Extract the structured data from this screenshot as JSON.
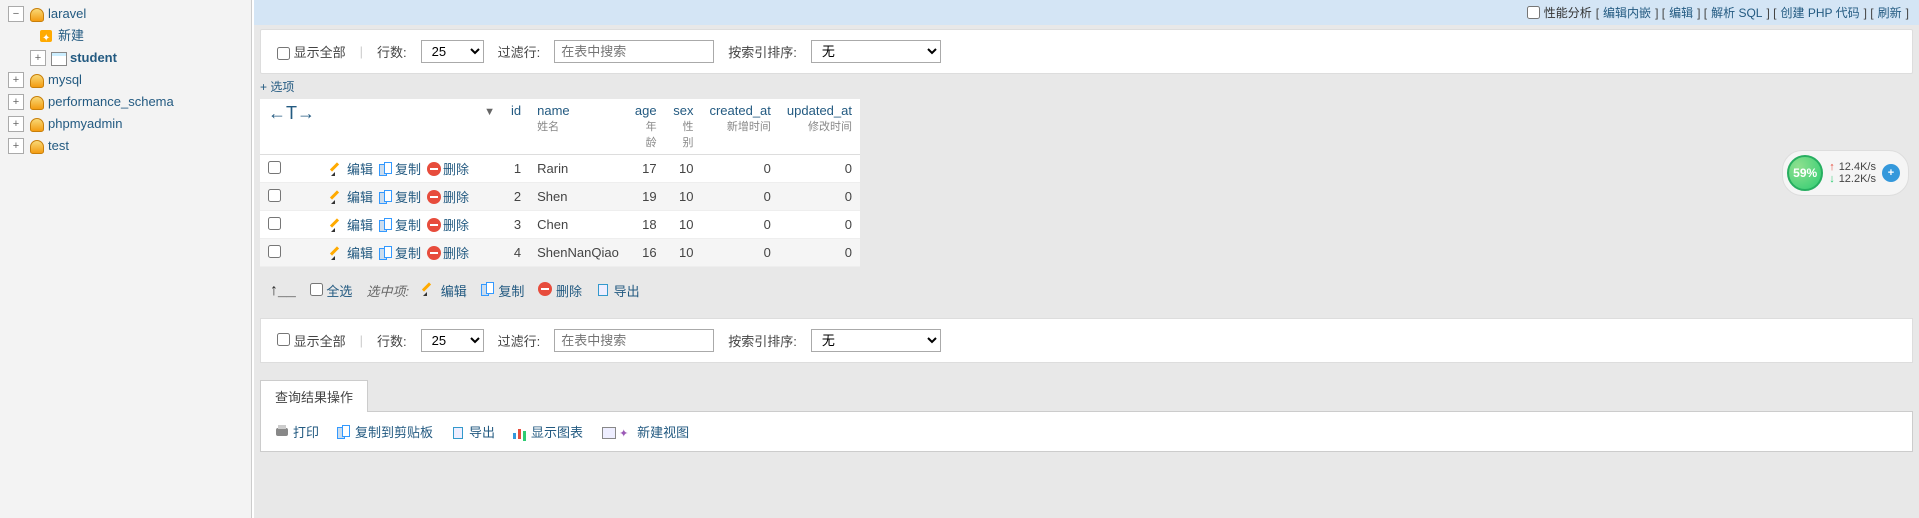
{
  "sidebar": {
    "items": [
      {
        "label": "laravel",
        "open": true,
        "icon": "db",
        "children": [
          {
            "label": "新建",
            "icon": "new"
          },
          {
            "label": "student",
            "icon": "table",
            "selected": true
          }
        ]
      },
      {
        "label": "mysql",
        "open": false,
        "icon": "db"
      },
      {
        "label": "performance_schema",
        "open": false,
        "icon": "db"
      },
      {
        "label": "phpmyadmin",
        "open": false,
        "icon": "db"
      },
      {
        "label": "test",
        "open": false,
        "icon": "db"
      }
    ]
  },
  "topbar": {
    "perf_label": "性能分析",
    "links": [
      "编辑内嵌",
      "编辑",
      "解析 SQL",
      "创建 PHP 代码",
      "刷新"
    ]
  },
  "controls": {
    "show_all": "显示全部",
    "rows_label": "行数:",
    "rows_value": "25",
    "filter_label": "过滤行:",
    "filter_placeholder": "在表中搜索",
    "sort_label": "按索引排序:",
    "sort_value": "无"
  },
  "options_link": "+ 选项",
  "table": {
    "headers": [
      {
        "key": "id",
        "sub": ""
      },
      {
        "key": "name",
        "sub": "姓名"
      },
      {
        "key": "age",
        "sub": "年龄"
      },
      {
        "key": "sex",
        "sub": "性别"
      },
      {
        "key": "created_at",
        "sub": "新增时间"
      },
      {
        "key": "updated_at",
        "sub": "修改时间"
      }
    ],
    "action_labels": {
      "edit": "编辑",
      "copy": "复制",
      "delete": "删除"
    },
    "rows": [
      {
        "id": 1,
        "name": "Rarin",
        "age": 17,
        "sex": 10,
        "created_at": 0,
        "updated_at": 0
      },
      {
        "id": 2,
        "name": "Shen",
        "age": 19,
        "sex": 10,
        "created_at": 0,
        "updated_at": 0
      },
      {
        "id": 3,
        "name": "Chen",
        "age": 18,
        "sex": 10,
        "created_at": 0,
        "updated_at": 0
      },
      {
        "id": 4,
        "name": "ShenNanQiao",
        "age": 16,
        "sex": 10,
        "created_at": 0,
        "updated_at": 0
      }
    ]
  },
  "bulk": {
    "select_all": "全选",
    "with_selected": "选中项:",
    "edit": "编辑",
    "copy": "复制",
    "delete": "删除",
    "export": "导出"
  },
  "result_ops": {
    "title": "查询结果操作",
    "print": "打印",
    "copy_clipboard": "复制到剪贴板",
    "export": "导出",
    "chart": "显示图表",
    "new_view": "新建视图"
  },
  "net": {
    "percent": "59%",
    "up": "12.4K/s",
    "down": "12.2K/s"
  }
}
